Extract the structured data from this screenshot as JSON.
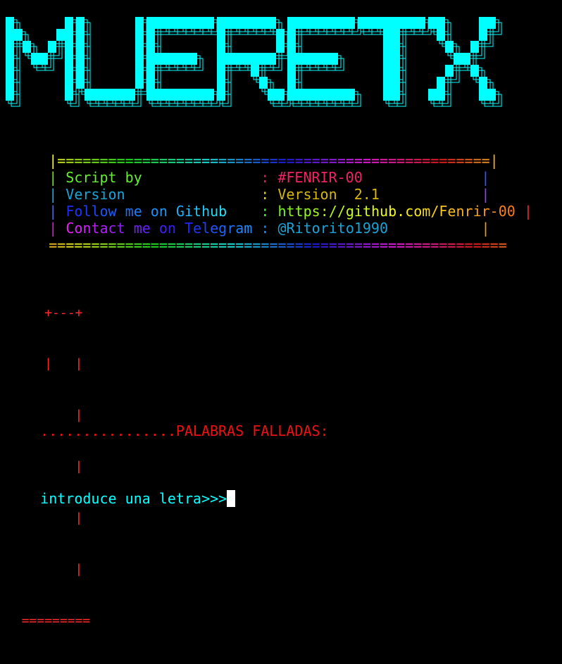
{
  "banner": {
    "text": "MUERETX",
    "color": "#00ffff",
    "shadow_color": "#00ffff"
  },
  "info_box": {
    "top_border": " |===================================================|",
    "bottom_border": " ======================================================",
    "rows": [
      {
        "pipe": " |",
        "label": " Script by              ",
        "sep": ": ",
        "value": "#FENRIR-00             ",
        "end": " |"
      },
      {
        "pipe": " |",
        "label": " Version                ",
        "sep": ": ",
        "value": "Version  2.1           ",
        "end": " |"
      },
      {
        "pipe": " |",
        "label": " Follow me on Github    ",
        "sep": ": ",
        "value": "https://github.com/Fenrir-00",
        "end": " |"
      },
      {
        "pipe": " |",
        "label": " Contact me on Telegram ",
        "sep": ": ",
        "value": "@Ritorito1990          ",
        "end": " |"
      }
    ]
  },
  "gallows": {
    "lines": [
      "     +---+",
      "     |   |",
      "         |",
      "         |",
      "         |",
      "         |",
      "  ========="
    ],
    "color": "#ff2a2a"
  },
  "failed_words": {
    "label": "................PALABRAS FALLADAS:",
    "color": "#ee1111"
  },
  "prompt": {
    "text": "introduce una letra>>>",
    "color": "#00ffff",
    "cursor_color": "#ffffff"
  }
}
